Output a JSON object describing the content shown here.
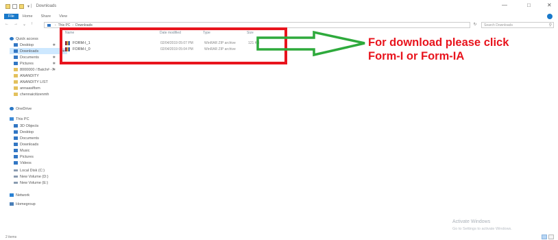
{
  "window": {
    "title": "Downloads",
    "controls": {
      "minimize": "—",
      "maximize": "□",
      "close": "✕"
    }
  },
  "ribbon": {
    "tabs": [
      "File",
      "Home",
      "Share",
      "View"
    ],
    "help_icon": "help-icon"
  },
  "address": {
    "nav": {
      "back": "←",
      "forward": "→",
      "up_menu": "⌄",
      "up": "↑"
    },
    "path": [
      "This PC",
      "Downloads"
    ],
    "refresh_glyph": "↻",
    "search_placeholder": "Search Downloads",
    "search_icon": "search-icon"
  },
  "sidebar": {
    "quick_access": {
      "label": "Quick access",
      "items": [
        {
          "label": "Desktop",
          "icon": "folder-blue-icon",
          "pinned": "✱"
        },
        {
          "label": "Downloads",
          "icon": "download-icon",
          "pinned": "✱",
          "selected": true
        },
        {
          "label": "Documents",
          "icon": "documents-icon",
          "pinned": "✱"
        },
        {
          "label": "Pictures",
          "icon": "pictures-icon",
          "pinned": "✱"
        },
        {
          "label": "8000000 / Batch# -7",
          "icon": "folder-icon",
          "pinned": "✱"
        },
        {
          "label": "ANANDITY",
          "icon": "folder-icon"
        },
        {
          "label": "ANANDITY LIST",
          "icon": "folder-icon"
        },
        {
          "label": "annaasiftsm",
          "icon": "folder-icon"
        },
        {
          "label": "chennaicitizenmh",
          "icon": "folder-icon"
        }
      ]
    },
    "onedrive": {
      "label": "OneDrive",
      "icon": "cloud-icon"
    },
    "this_pc": {
      "label": "This PC",
      "items": [
        {
          "label": "3D Objects",
          "icon": "cube-icon"
        },
        {
          "label": "Desktop",
          "icon": "folder-blue-icon"
        },
        {
          "label": "Documents",
          "icon": "documents-icon"
        },
        {
          "label": "Downloads",
          "icon": "download-icon"
        },
        {
          "label": "Music",
          "icon": "music-icon"
        },
        {
          "label": "Pictures",
          "icon": "pictures-icon"
        },
        {
          "label": "Videos",
          "icon": "video-icon"
        },
        {
          "label": "Local Disk (C:)",
          "icon": "drive-icon"
        },
        {
          "label": "New Volume (D:)",
          "icon": "drive-icon"
        },
        {
          "label": "New Volume (E:)",
          "icon": "drive-icon"
        }
      ]
    },
    "network": {
      "label": "Network",
      "icon": "network-icon"
    },
    "homegroup": {
      "label": "Homegroup",
      "icon": "homegroup-icon"
    }
  },
  "columns": {
    "name": "Name",
    "date": "Date modified",
    "type": "Type",
    "size": "Size"
  },
  "files": [
    {
      "name": "FORM-I_1",
      "date": "02/04/2019 05:07 PM",
      "type": "WinRAR ZIP archive",
      "size": "121 KB"
    },
    {
      "name": "FORM-I_0",
      "date": "02/04/2019 05:04 PM",
      "type": "WinRAR ZIP archive",
      "size": ""
    }
  ],
  "annotation": {
    "text": "For download please click Form-I or Form-IA",
    "color": "#e8141d",
    "box_color": "#e8141d",
    "arrow_color": "#2eaa3c"
  },
  "watermark": {
    "title": "Activate Windows",
    "subtitle": "Go to Settings to activate Windows."
  },
  "status": {
    "item_count": "2 items"
  }
}
